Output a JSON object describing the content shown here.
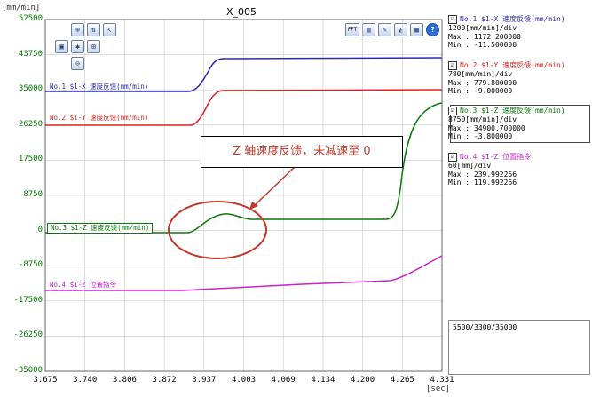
{
  "window": {
    "title": "X_005",
    "y_unit": "[mm/min]",
    "x_unit": "[sec]"
  },
  "toolbar": {
    "left_icons": [
      "zoom-in-icon",
      "zoom-vertical-icon",
      "cursor-icon",
      "zoom-fit-icon",
      "marker-icon",
      "zoom-box-icon",
      "zoom-out-icon"
    ],
    "right_icons": [
      "fft-icon",
      "bar-chart-icon",
      "measure-icon",
      "settings-icon",
      "palette-icon",
      "help-icon"
    ],
    "fft_label": "FFT",
    "help_label": "?"
  },
  "axes": {
    "y_ticks": [
      "52500",
      "43750",
      "35000",
      "26250",
      "17500",
      "8750",
      "0",
      "-8750",
      "-17500",
      "-26250",
      "-35000"
    ],
    "x_ticks": [
      "3.675",
      "3.740",
      "3.806",
      "3.872",
      "3.937",
      "4.003",
      "4.069",
      "4.134",
      "4.200",
      "4.265",
      "4.331"
    ]
  },
  "plot_labels": [
    {
      "text": "No.1 $1-X 速度反馈(mm/min)",
      "color": "#2b2bb0"
    },
    {
      "text": "No.2 $1-Y 速度反馈(mm/min)",
      "color": "#d92323"
    },
    {
      "text": "No.3 $1-Z 速度反馈(mm/min)",
      "color": "#0a7a0a"
    },
    {
      "text": "No.4 $1-Z 位置指令",
      "color": "#cc22cc"
    }
  ],
  "annotation": {
    "text": "Z 轴速度反馈，未减速至 0",
    "color": "#c0392b"
  },
  "channels": [
    {
      "checkbox": "☑",
      "title": "No.1 $1-X 速度反馈(mm/min)",
      "div": "1200[mm/min]/div",
      "max": "Max  : 1172.200000",
      "min": "Min  : -11.500000",
      "color": "#2b2bb0"
    },
    {
      "checkbox": "☑",
      "title": "No.2 $1-Y 速度反馈(mm/min)",
      "div": "780[mm/min]/div",
      "max": "Max  : 779.800000",
      "min": "Min  : -9.000000",
      "color": "#d92323"
    },
    {
      "checkbox": "☑",
      "title": "No.3 $1-Z 速度反馈(mm/min)",
      "div": "8750[mm/min]/div",
      "max": "Max  : 34900.700000",
      "min": "Min  : -3.800000",
      "color": "#0a7a0a"
    },
    {
      "checkbox": "☑",
      "title": "No.4 $1-Z 位置指令",
      "div": "60[mm]/div",
      "max": "Max  : 239.992266",
      "min": "Min  : 119.992266",
      "color": "#cc22cc"
    }
  ],
  "status_box": {
    "text": "5500/3300/35000"
  },
  "colors": {
    "grid": "#c8c8c8",
    "annotation_ellipse": "#c0392b",
    "axis_text": "#007a00"
  }
}
